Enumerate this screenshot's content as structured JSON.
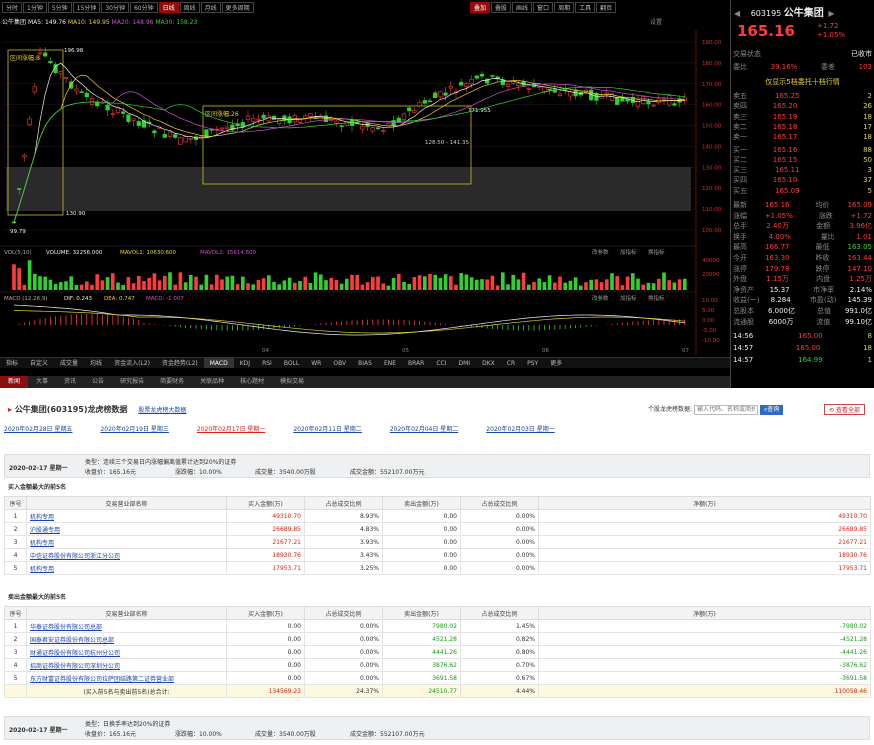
{
  "colors": {
    "up": "#ff3b3b",
    "down": "#2ed12e",
    "bg": "#000000",
    "accent": "#8a1010"
  },
  "chart_toolbar": {
    "tabs": [
      "分时",
      "1分钟",
      "5分钟",
      "15分钟",
      "30分钟",
      "60分钟",
      "日线",
      "周线",
      "月线",
      "更多周期"
    ],
    "active": "日线",
    "stock_short": "公牛集团",
    "ma_legend": {
      "ma5": "MA5: 149.76",
      "ma10": "MA10: 149.95",
      "ma20": "MA20: 148.96",
      "ma30": "MA30: 158.23"
    },
    "right_tools": [
      "叠加",
      "叠股",
      "画线",
      "窗口",
      "周期",
      "工具",
      "翻页"
    ],
    "settings": "设置"
  },
  "price_axis": [
    "190.00",
    "180.00",
    "170.00",
    "160.00",
    "150.00",
    "140.00",
    "130.00",
    "120.00",
    "110.00",
    "100.00"
  ],
  "annotations": {
    "high": "196.98",
    "p1": "171.955",
    "low": "130.90",
    "start": "99.79",
    "a": "区间涨幅:8",
    "b": "区间涨幅:26",
    "c": "128.50",
    "d": "141.35"
  },
  "volume": {
    "label": "VOL(5,10)",
    "vol": "VOLUME: 32256.000",
    "mavol1": "MAVOL1: 10630.600",
    "mavol2": "MAVOL2: 15614.600",
    "axis": [
      "40000",
      "20000"
    ],
    "btns": [
      "改参数",
      "加指标",
      "换指标"
    ]
  },
  "macd": {
    "label": "MACD (12,26,9)",
    "dif": "DIF: 0.243",
    "dea": "DEA: 0.747",
    "macd": "MACD: -1.007",
    "axis": [
      "10.00",
      "5.00",
      "0.00",
      "-5.00",
      "-10.00"
    ]
  },
  "months": [
    "04",
    "05",
    "06",
    "07"
  ],
  "bottom_tabs": [
    "指标",
    "自定义",
    "成交量",
    "均线",
    "资金流入(L2)",
    "资金趋势(L2)",
    "MACD",
    "KDJ",
    "RSI",
    "BOLL",
    "WR",
    "OBV",
    "BIAS",
    "ENE",
    "BRAR",
    "CCI",
    "DMI",
    "DKX",
    "CR",
    "PSY",
    "更多"
  ],
  "bottom_tab_active": "MACD",
  "news_tabs": [
    "新闻",
    "大事",
    "资讯",
    "公告",
    "研究报告",
    "简要财务",
    "关联品种",
    "核心题材",
    "模拟交易"
  ],
  "news_active": "新闻",
  "quote": {
    "code": "603195",
    "name": "公牛集团",
    "price": "165.16",
    "change": "+1.72",
    "pct": "+1.05%",
    "status_label": "交易状态",
    "status": "已收市",
    "wb_label": "委比",
    "wb": "39.16%",
    "wc_label": "委差",
    "wc": "103",
    "level_title": "仅显示5档委托十档行情",
    "sells": [
      [
        "卖五",
        "165.25",
        "2"
      ],
      [
        "卖四",
        "165.20",
        "26"
      ],
      [
        "卖三",
        "165.19",
        "18"
      ],
      [
        "卖二",
        "165.18",
        "17"
      ],
      [
        "卖一",
        "165.17",
        "18"
      ]
    ],
    "buys": [
      [
        "买一",
        "165.16",
        "88"
      ],
      [
        "买二",
        "165.15",
        "50"
      ],
      [
        "买三",
        "165.11",
        "3"
      ],
      [
        "买四",
        "165.10",
        "37"
      ],
      [
        "买五",
        "165.09",
        "5"
      ]
    ],
    "stats": [
      [
        "最新",
        "165.16",
        "均价",
        "165.09"
      ],
      [
        "涨幅",
        "+1.05%",
        "涨跌",
        "+1.72"
      ],
      [
        "总手",
        "2.40万",
        "金额",
        "3.96亿"
      ],
      [
        "换手",
        "4.00%",
        "量比",
        "1.01"
      ],
      [
        "最高",
        "166.77",
        "最低",
        "163.05"
      ],
      [
        "今开",
        "163.30",
        "昨收",
        "163.44"
      ],
      [
        "涨停",
        "179.78",
        "跌停",
        "147.10"
      ],
      [
        "外盘",
        "1.15万",
        "内盘",
        "1.25万"
      ],
      [
        "净资产",
        "15.37",
        "市净率",
        "2.14%"
      ],
      [
        "收益(一)",
        "8.284",
        "市盈(动)",
        "145.39"
      ],
      [
        "总股本",
        "6.000亿",
        "总值",
        "991.0亿"
      ],
      [
        "流通股",
        "6000万",
        "流值",
        "99.10亿"
      ]
    ],
    "ticks": [
      [
        "14:56",
        "165.00",
        "8"
      ],
      [
        "14:57",
        "165.00",
        "18"
      ],
      [
        "14:57",
        "164.99",
        "1"
      ]
    ]
  },
  "page": {
    "title": "公牛集团(603195)龙虎榜数据",
    "title_link": "股票龙虎榜大数据",
    "search_label": "个股龙虎榜数据:",
    "search_placeholder": "输入代码、名称或简拼",
    "search_btn": "查询",
    "all_btn": "查看全部",
    "dates": [
      "2020年02月28日 星期五",
      "2020年02月19日 星期三",
      "2020年02月17日 星期一",
      "2020年02月11日 星期二",
      "2020年02月04日 星期二",
      "2020年02月03日 星期一"
    ],
    "active_date": "2020年02月17日 星期一",
    "record1": {
      "date": "2020-02-17 星期一",
      "type": "类型：连续三个交易日内涨幅偏离值累计达到20%的证券",
      "close": "收盘价：165.16元",
      "pct": "涨跌幅：10.00%",
      "vol": "成交量：3540.00万股",
      "amt": "成交金额：552107.00万元"
    },
    "buy_title": "买入金额最大的前5名",
    "sell_title": "卖出金额最大的前5名",
    "headers": [
      "序号",
      "交易营业部名称",
      "买入金额(万)",
      "占总成交比例",
      "卖出金额(万)",
      "占总成交比例",
      "净额(万)"
    ],
    "buy_rows": [
      [
        "1",
        "机构专用",
        "49310.70",
        "8.93%",
        "0.00",
        "0.00%",
        "49310.70"
      ],
      [
        "2",
        "沪股通专用",
        "26689.85",
        "4.83%",
        "0.00",
        "0.00%",
        "26689.85"
      ],
      [
        "3",
        "机构专用",
        "21677.21",
        "3.93%",
        "0.00",
        "0.00%",
        "21677.21"
      ],
      [
        "4",
        "中信证券股份有限公司浙江分公司",
        "18930.76",
        "3.43%",
        "0.00",
        "0.00%",
        "18930.76"
      ],
      [
        "5",
        "机构专用",
        "17953.71",
        "3.25%",
        "0.00",
        "0.00%",
        "17953.71"
      ]
    ],
    "sell_rows": [
      [
        "1",
        "华泰证券股份有限公司总部",
        "0.00",
        "0.00%",
        "7980.02",
        "1.45%",
        "-7980.02"
      ],
      [
        "2",
        "国泰君安证券股份有限公司总部",
        "0.00",
        "0.00%",
        "4521.28",
        "0.82%",
        "-4521.28"
      ],
      [
        "3",
        "财通证券股份有限公司杭州分公司",
        "0.00",
        "0.00%",
        "4441.26",
        "0.80%",
        "-4441.26"
      ],
      [
        "4",
        "招商证券股份有限公司深圳分公司",
        "0.00",
        "0.00%",
        "3876.62",
        "0.70%",
        "-3876.62"
      ],
      [
        "5",
        "东方财富证券股份有限公司拉萨团结路第二证券营业部",
        "0.00",
        "0.00%",
        "3691.58",
        "0.67%",
        "-3691.58"
      ]
    ],
    "total": [
      "",
      "(买入前5名与卖出前5名)总合计:",
      "134569.23",
      "24.37%",
      "24510.77",
      "4.44%",
      "110058.46"
    ],
    "record2": {
      "date": "2020-02-17 星期一",
      "type": "类型：日换手率达到20%的证券",
      "close": "收盘价：165.16元",
      "pct": "涨跌幅：10.00%",
      "vol": "成交量：3540.00万股",
      "amt": "成交金额：552107.00万元"
    }
  }
}
